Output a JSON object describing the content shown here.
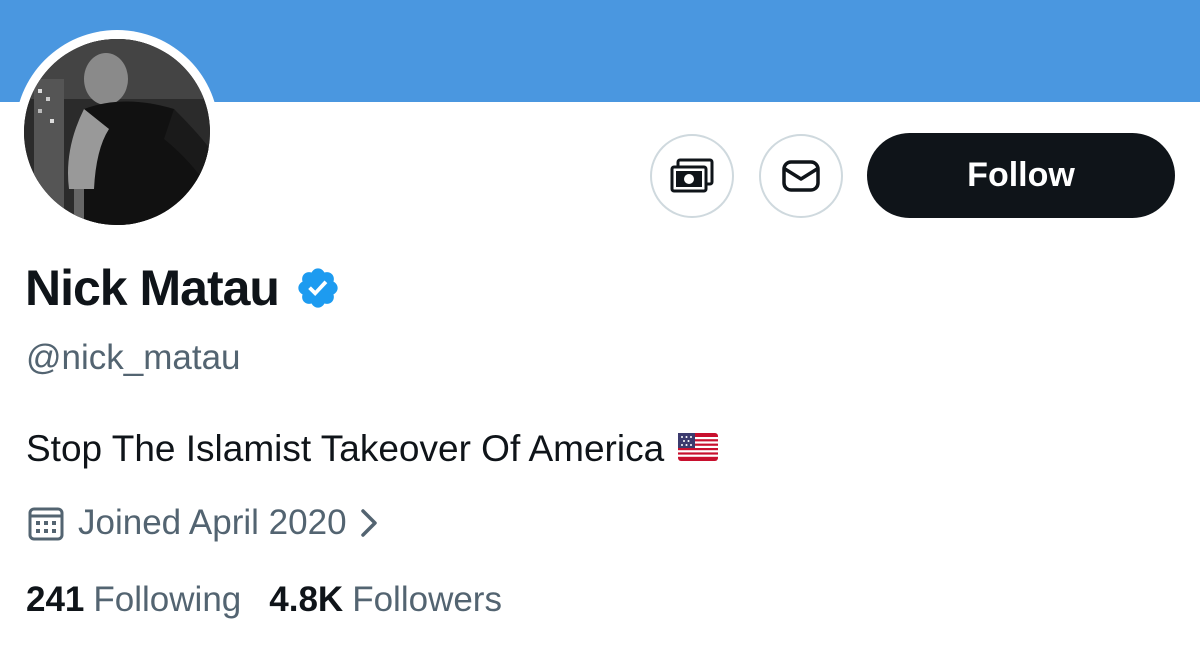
{
  "profile": {
    "display_name": "Nick Matau",
    "verified": true,
    "handle": "@nick_matau",
    "bio": "Stop The Islamist Takeover Of America",
    "bio_emoji": "us-flag",
    "joined": "Joined April 2020",
    "following_count": "241",
    "following_label": "Following",
    "followers_count": "4.8K",
    "followers_label": "Followers"
  },
  "actions": {
    "tip_icon": "money-icon",
    "message_icon": "envelope-icon",
    "follow_label": "Follow"
  },
  "colors": {
    "banner": "#4a97e0",
    "verified_badge": "#1d9bf0",
    "follow_button": "#0f1419",
    "secondary_text": "#536471"
  }
}
